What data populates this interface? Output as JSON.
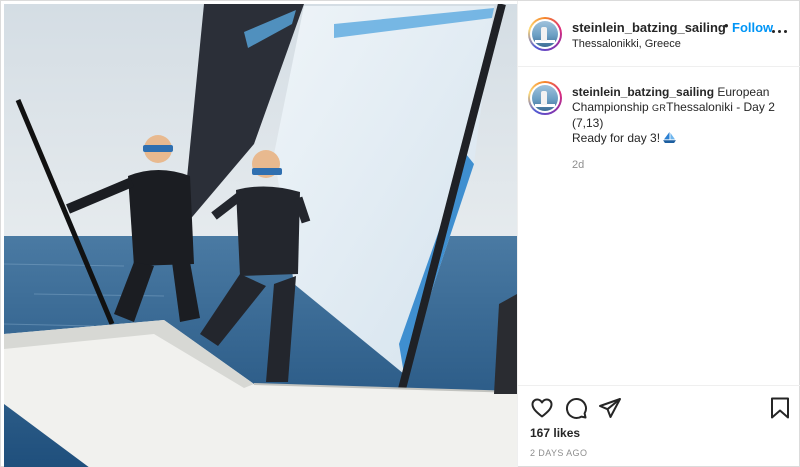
{
  "post": {
    "username": "steinlein_batzing_sailing",
    "dot": "•",
    "follow_label": "Follow",
    "location": "Thessalonikki, Greece",
    "caption": {
      "username": "steinlein_batzing_sailing",
      "line1": "European",
      "line2_prefix": "Championship ",
      "flag_text": "GR",
      "line2_suffix": "Thessaloniki - Day 2",
      "line3": "(7,13)",
      "line4": "Ready for day 3!",
      "emoji_icon": "sailboat-emoji-icon"
    },
    "time_ago": "2d",
    "likes": "167 likes",
    "posted": "2 DAYS AGO"
  },
  "icons": {
    "more": "more-options-icon",
    "like": "heart-icon",
    "comment": "comment-icon",
    "share": "send-icon",
    "save": "bookmark-icon"
  },
  "colors": {
    "accent": "#0095f6",
    "text": "#262626",
    "muted": "#8e8e8e",
    "border": "#dbdbdb"
  }
}
